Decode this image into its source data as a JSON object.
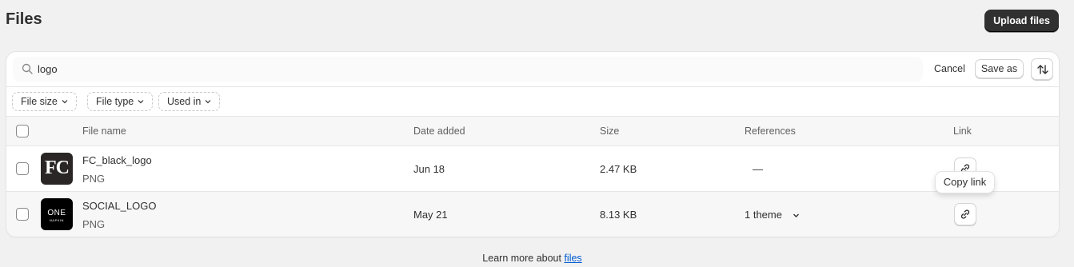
{
  "page": {
    "title": "Files",
    "upload_button": "Upload files"
  },
  "search": {
    "value": "logo",
    "cancel_label": "Cancel",
    "save_as_label": "Save as"
  },
  "filters": [
    {
      "label": "File size"
    },
    {
      "label": "File type"
    },
    {
      "label": "Used in"
    }
  ],
  "table": {
    "headers": {
      "file_name": "File name",
      "date_added": "Date added",
      "size": "Size",
      "references": "References",
      "link": "Link"
    },
    "rows": [
      {
        "name": "FC_black_logo",
        "type": "PNG",
        "date": "Jun 18",
        "size": "2.47 KB",
        "references": "—",
        "thumbnail_text": "FC"
      },
      {
        "name": "SOCIAL_LOGO",
        "type": "PNG",
        "date": "May 21",
        "size": "8.13 KB",
        "references": "1 theme",
        "thumbnail_text": "ONE",
        "thumbnail_subtext": "NAPKIN"
      }
    ]
  },
  "tooltip": {
    "text": "Copy link"
  },
  "footer": {
    "text": "Learn more about ",
    "link_text": "files"
  },
  "colors": {
    "background": "#f1f1f1",
    "primary_button": "#303030",
    "link": "#005bd3"
  }
}
